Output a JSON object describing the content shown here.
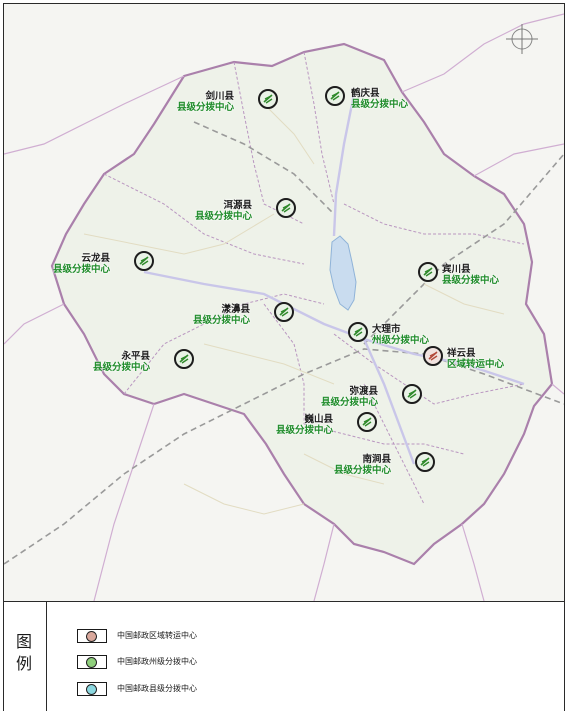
{
  "map": {
    "hubs": [
      {
        "id": "jianchuan",
        "name": "剑川县",
        "kind": "县级分拨中心",
        "type": "county"
      },
      {
        "id": "heqing",
        "name": "鹤庆县",
        "kind": "县级分拨中心",
        "type": "county"
      },
      {
        "id": "eryuan",
        "name": "洱源县",
        "kind": "县级分拨中心",
        "type": "county"
      },
      {
        "id": "yunlong",
        "name": "云龙县",
        "kind": "县级分拨中心",
        "type": "county"
      },
      {
        "id": "binchuan",
        "name": "宾川县",
        "kind": "县级分拨中心",
        "type": "county"
      },
      {
        "id": "yangbi",
        "name": "漾濞县",
        "kind": "县级分拨中心",
        "type": "county"
      },
      {
        "id": "dali",
        "name": "大理市",
        "kind": "州级分拨中心",
        "type": "prefecture"
      },
      {
        "id": "xiangyun",
        "name": "祥云县",
        "kind": "区域转运中心",
        "type": "region"
      },
      {
        "id": "yongping",
        "name": "永平县",
        "kind": "县级分拨中心",
        "type": "county"
      },
      {
        "id": "midu",
        "name": "弥渡县",
        "kind": "县级分拨中心",
        "type": "county"
      },
      {
        "id": "weishan",
        "name": "巍山县",
        "kind": "县级分拨中心",
        "type": "county"
      },
      {
        "id": "nanjian",
        "name": "南涧县",
        "kind": "县级分拨中心",
        "type": "county"
      }
    ]
  },
  "legend": {
    "title_1": "图",
    "title_2": "例",
    "items": [
      {
        "label": "中国邮政区域转运中心",
        "type": "region"
      },
      {
        "label": "中国邮政州级分拨中心",
        "type": "prefecture"
      },
      {
        "label": "中国邮政县级分拨中心",
        "type": "county"
      }
    ]
  },
  "colors": {
    "hub_label_green": "#1f8c2a",
    "region_fill": "#f1e3df",
    "county_fill": "#e9f2e6",
    "boundary_purple": "#a77aa8",
    "lake_blue": "#c9dcef"
  }
}
